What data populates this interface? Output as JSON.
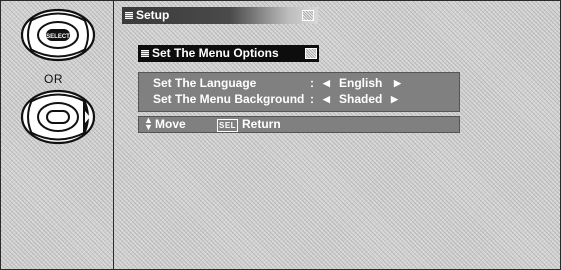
{
  "left_panel": {
    "remote_top": {
      "button_label": "SELECT"
    },
    "or_label": "OR",
    "remote_bottom": {
      "button_label": ""
    }
  },
  "osd": {
    "window_title": "Setup",
    "submenu_title": "Set The Menu Options",
    "options": [
      {
        "label": "Set The Language",
        "separator": ":",
        "value": "English"
      },
      {
        "label": "Set The Menu Background",
        "separator": ":",
        "value": "Shaded"
      }
    ],
    "help": {
      "move_label": "Move",
      "sel_key": "SEL",
      "return_label": "Return"
    }
  },
  "icons": {
    "title_mark": "menu-bars-icon",
    "title_box": "exit-box-icon",
    "arrow_left": "triangle-left-icon",
    "arrow_right": "triangle-right-icon",
    "updown": "up-down-arrows-icon"
  },
  "colors": {
    "osd_panel": "#808080",
    "osd_text": "#ffffff",
    "submenu_bg": "#0d0d0d",
    "title_bar": "#3a3a3a"
  }
}
